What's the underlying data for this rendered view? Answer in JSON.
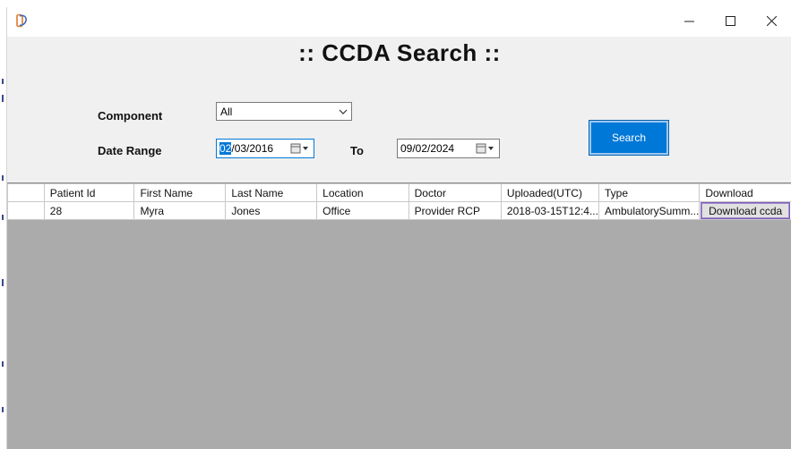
{
  "window": {
    "icon": "ccda-logo-icon",
    "controls": {
      "minimize": "minimize-icon",
      "maximize": "maximize-icon",
      "close": "close-icon"
    }
  },
  "form": {
    "title": ":: CCDA Search ::",
    "component_label": "Component",
    "component_value": "All",
    "date_range_label": "Date Range",
    "date_from_selected": "02",
    "date_from_rest": "/03/2016",
    "to_label": "To",
    "date_to": "09/02/2024",
    "search_label": "Search"
  },
  "grid": {
    "columns": [
      "Patient Id",
      "First Name",
      "Last Name",
      "Location",
      "Doctor",
      "Uploaded(UTC)",
      "Type",
      "Download"
    ],
    "rows": [
      {
        "patient_id": "28",
        "first_name": "Myra",
        "last_name": "Jones",
        "location": "Office",
        "doctor": "Provider RCP",
        "uploaded": "2018-03-15T12:4...",
        "type": "AmbulatorySumm...",
        "download": "Download ccda"
      }
    ]
  },
  "colors": {
    "accent": "#0078d7",
    "grid_background": "#ababab",
    "form_background": "#f0f0f0"
  }
}
